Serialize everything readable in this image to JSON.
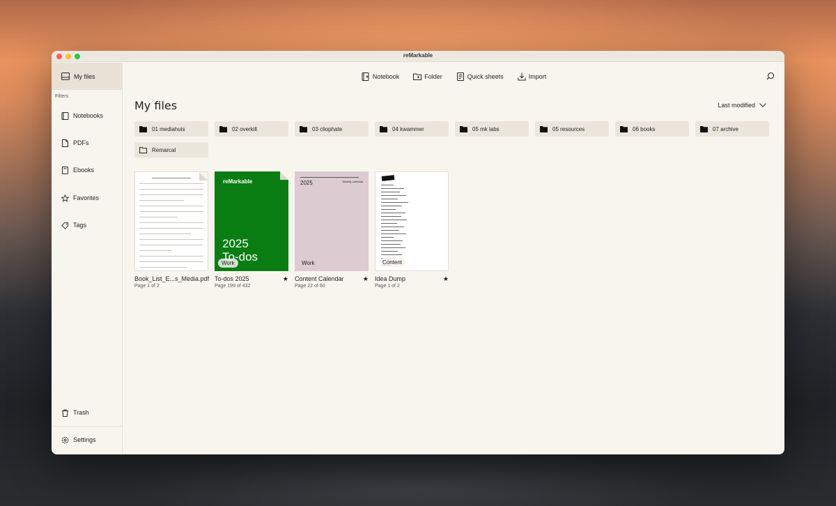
{
  "window": {
    "title": "reMarkable"
  },
  "sidebar": {
    "top_item": {
      "label": "My files",
      "icon": "tray-icon"
    },
    "filters_label": "Filters",
    "items": [
      {
        "label": "Notebooks",
        "icon": "notebook-icon"
      },
      {
        "label": "PDFs",
        "icon": "pdf-icon"
      },
      {
        "label": "Ebooks",
        "icon": "ebook-icon"
      },
      {
        "label": "Favorites",
        "icon": "star-icon"
      },
      {
        "label": "Tags",
        "icon": "tag-icon"
      }
    ],
    "trash_label": "Trash",
    "settings_label": "Settings"
  },
  "toolbar": {
    "notebook_label": "Notebook",
    "folder_label": "Folder",
    "quick_sheets_label": "Quick sheets",
    "import_label": "Import"
  },
  "main": {
    "heading": "My files",
    "sort_label": "Last modified"
  },
  "folders": [
    {
      "name": "01 mediahuis",
      "filled": true
    },
    {
      "name": "02 overkill",
      "filled": true
    },
    {
      "name": "03 cliophate",
      "filled": true
    },
    {
      "name": "04 kwammer",
      "filled": true
    },
    {
      "name": "05 mk labs",
      "filled": true
    },
    {
      "name": "05 resources",
      "filled": true
    },
    {
      "name": "06 books",
      "filled": true
    },
    {
      "name": "07 archive",
      "filled": true
    },
    {
      "name": "Remarcal",
      "filled": false
    }
  ],
  "files": [
    {
      "name": "Book_List_E...s_Media.pdf",
      "meta": "Page 1 of 2",
      "tag": "",
      "starred": false
    },
    {
      "name": "To-dos 2025",
      "meta": "Page 199 of 432",
      "tag": "Work",
      "starred": true,
      "cover_brand": "reMarkable",
      "cover_year": "2025",
      "cover_title": "To-dos"
    },
    {
      "name": "Content Calendar",
      "meta": "Page 22 of 60",
      "tag": "Work",
      "starred": true,
      "cover_year": "2025",
      "cover_label": "Weekly calendar"
    },
    {
      "name": "Idea Dump",
      "meta": "Page 1 of 2",
      "tag": "Content",
      "starred": true
    }
  ],
  "colors": {
    "todos_cover": "#0a7d12",
    "calendar_cover": "#dccbd0",
    "window_bg": "#f8f5ef",
    "folder_bg": "#ebe6dc"
  }
}
